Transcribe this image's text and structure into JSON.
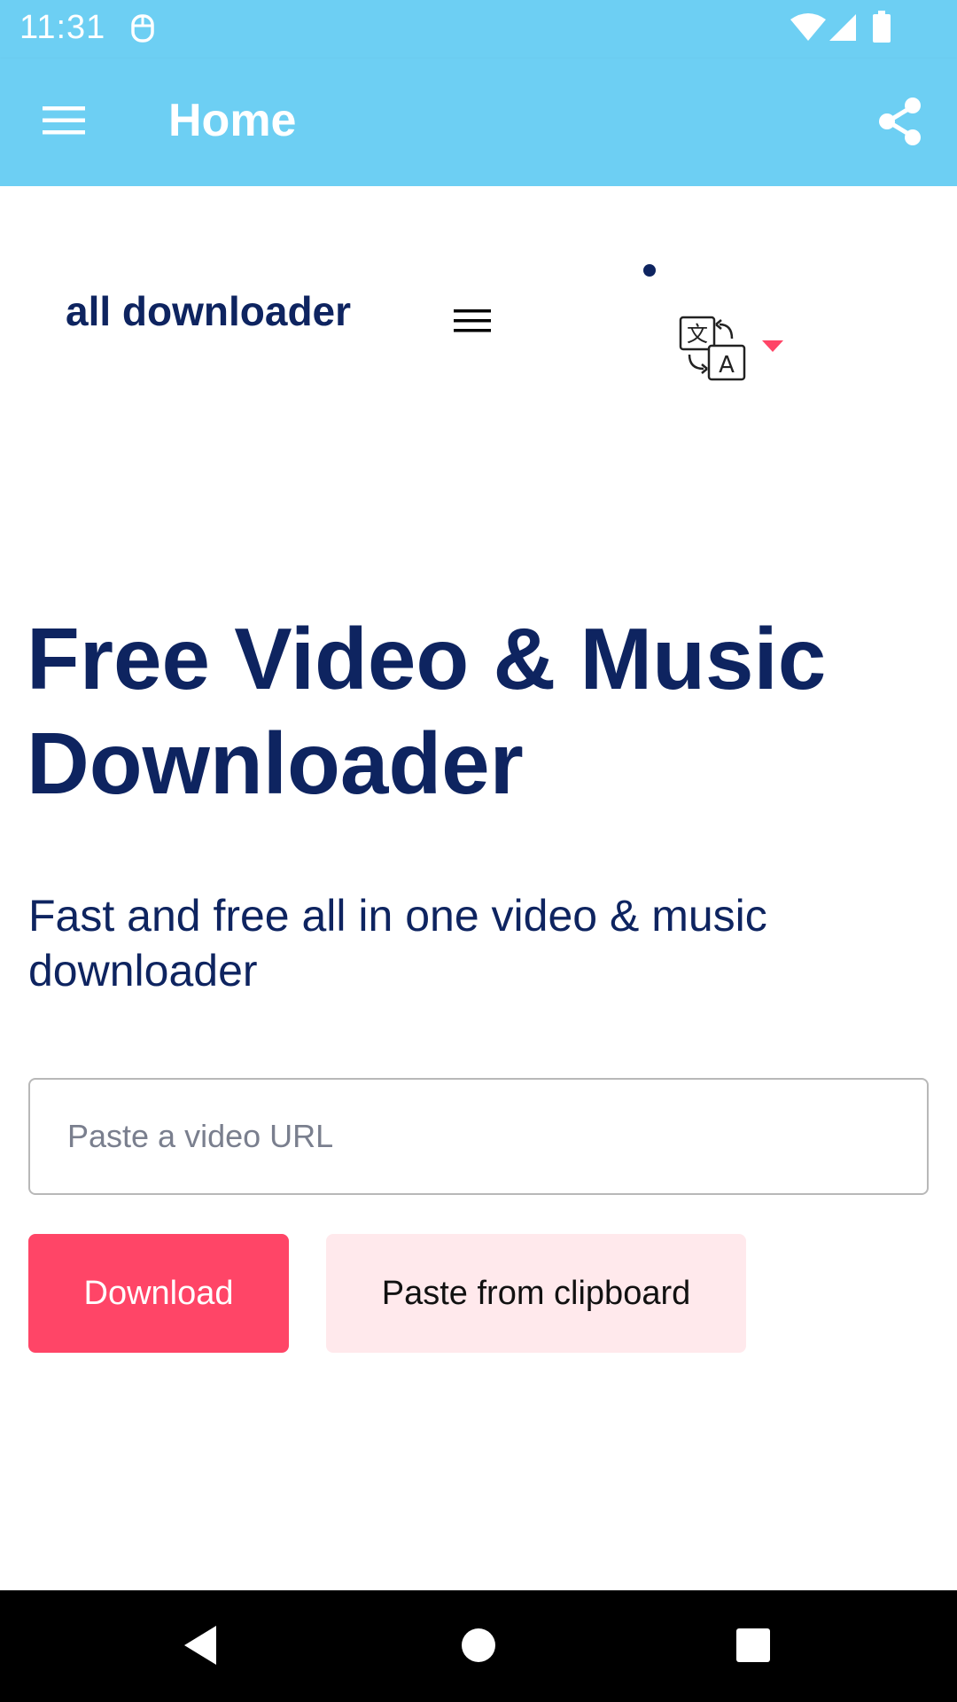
{
  "status_bar": {
    "time": "11:31",
    "icons": [
      "notification-icon",
      "wifi-icon",
      "signal-icon",
      "battery-icon"
    ]
  },
  "app_bar": {
    "title": "Home",
    "menu_icon": "hamburger-menu-icon",
    "share_icon": "share-icon"
  },
  "site_header": {
    "logo_text": "all downloader",
    "menu_icon": "hamburger-menu-icon",
    "language_icon": "translate-icon",
    "language_caret": "caret-down-icon"
  },
  "hero": {
    "title": "Free Video & Music Downloader",
    "subtitle": "Fast and free all in one video & music downloader"
  },
  "url_form": {
    "placeholder": "Paste a video URL",
    "value": "",
    "download_label": "Download",
    "paste_label": "Paste from clipboard"
  },
  "nav_bar": {
    "icons": [
      "back-icon",
      "home-icon",
      "recents-icon"
    ]
  },
  "colors": {
    "app_bar": "#6dcff3",
    "heading_text": "#0e2460",
    "download_button": "#ff4567",
    "paste_button": "#ffe9ec",
    "nav_bar": "#000000"
  }
}
